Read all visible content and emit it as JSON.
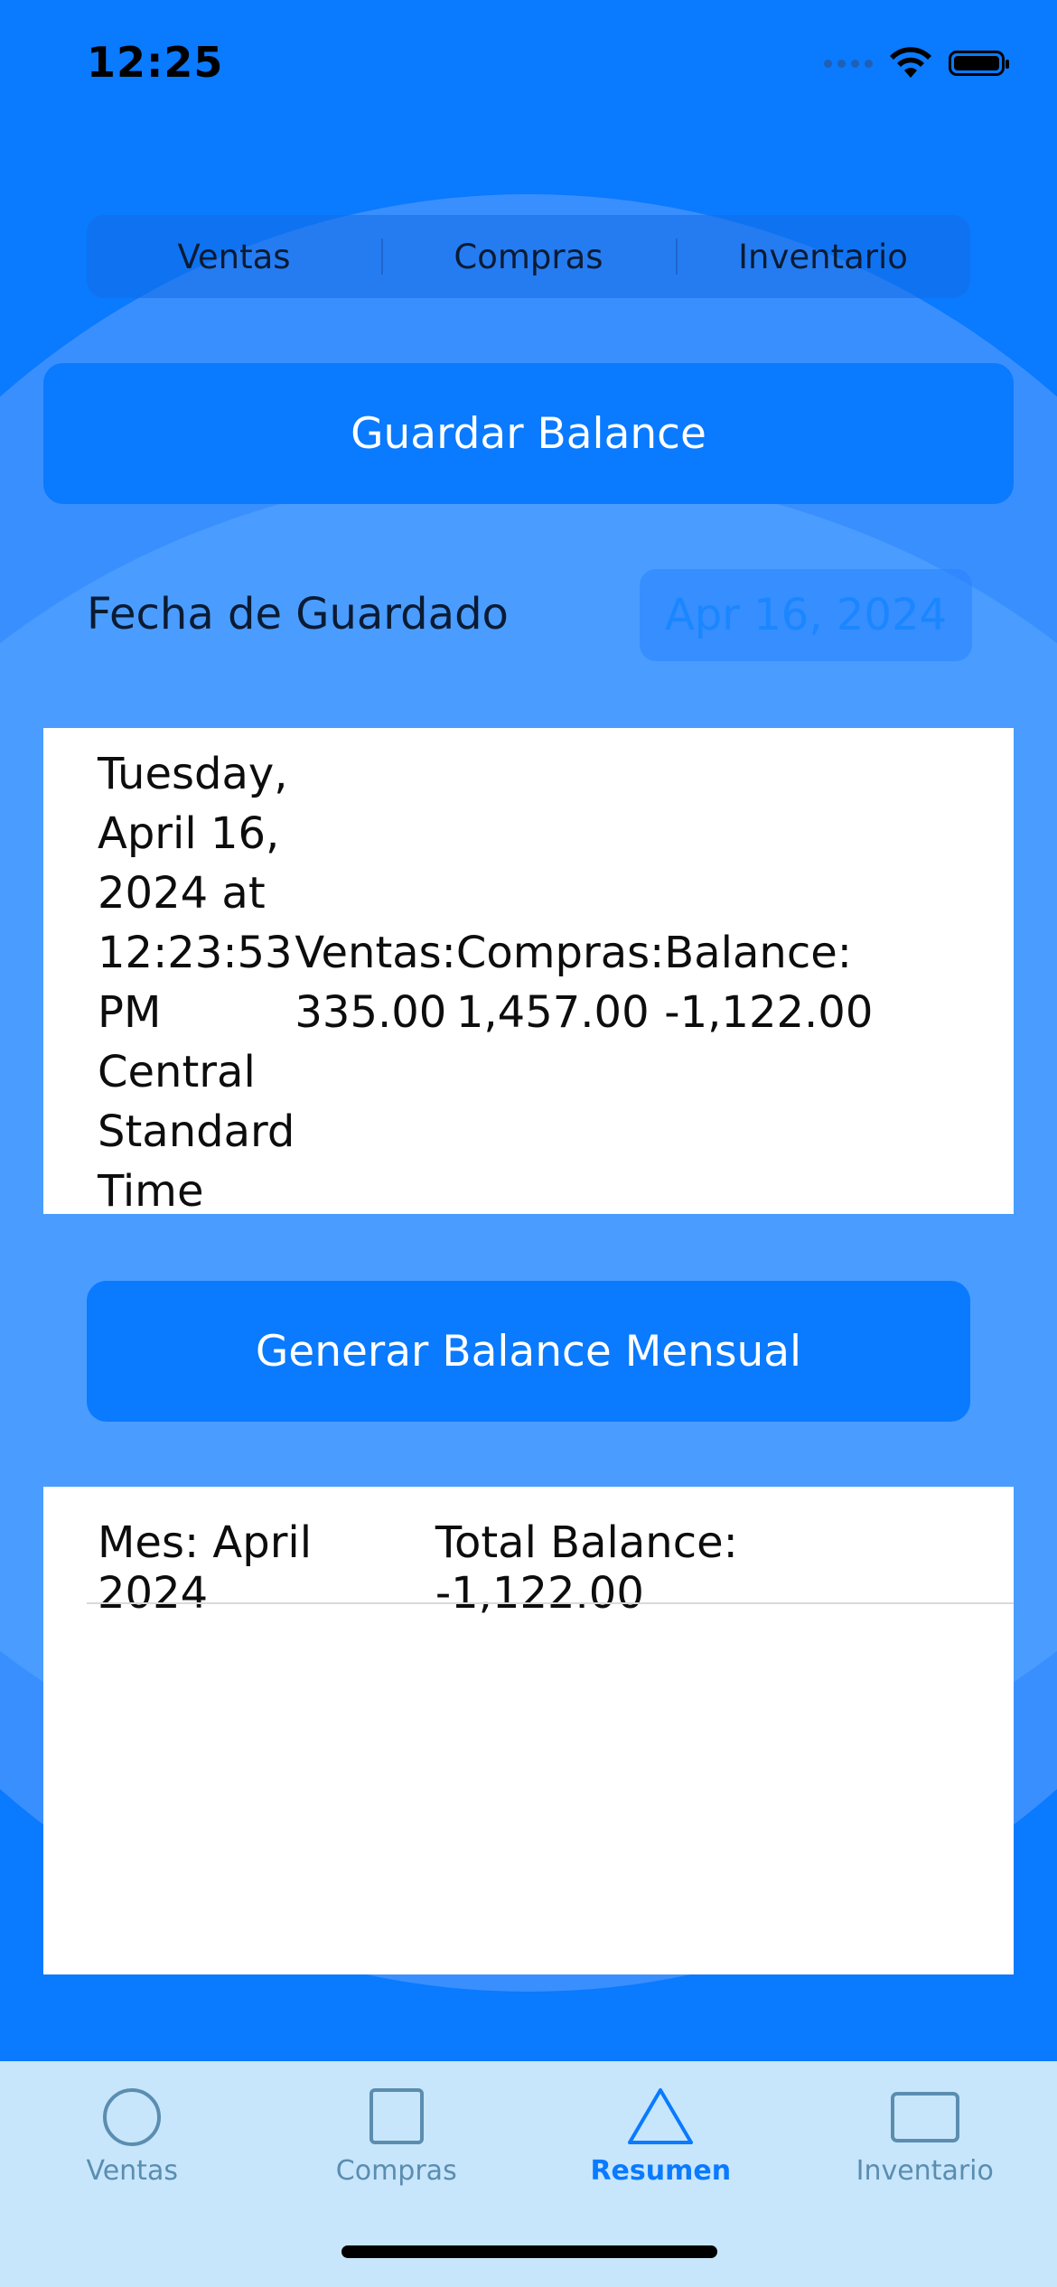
{
  "status_bar": {
    "time": "12:25"
  },
  "segments": [
    "Ventas",
    "Compras",
    "Inventario"
  ],
  "save_button_label": "Guardar Balance",
  "date_row": {
    "label": "Fecha de Guardado",
    "value": "Apr 16, 2024"
  },
  "record": {
    "date": "Tuesday, April 16, 2024 at 12:23:53 PM Central Standard Time",
    "ventas": "Ventas: 335.00",
    "compras": "Compras: 1,457.00",
    "balance": "Balance: -1,122.00"
  },
  "generate_button_label": "Generar Balance Mensual",
  "monthly": {
    "month": "Mes: April 2024",
    "total": "Total Balance: -1,122.00"
  },
  "tabs": [
    {
      "label": "Ventas",
      "icon": "circle-icon"
    },
    {
      "label": "Compras",
      "icon": "square-icon"
    },
    {
      "label": "Resumen",
      "icon": "triangle-icon"
    },
    {
      "label": "Inventario",
      "icon": "rectangle-icon"
    }
  ],
  "colors": {
    "background": "#0a7aff",
    "button": "#0a7aff",
    "tabbar": "#c7e6fb",
    "active_tab": "#0a7aff"
  }
}
